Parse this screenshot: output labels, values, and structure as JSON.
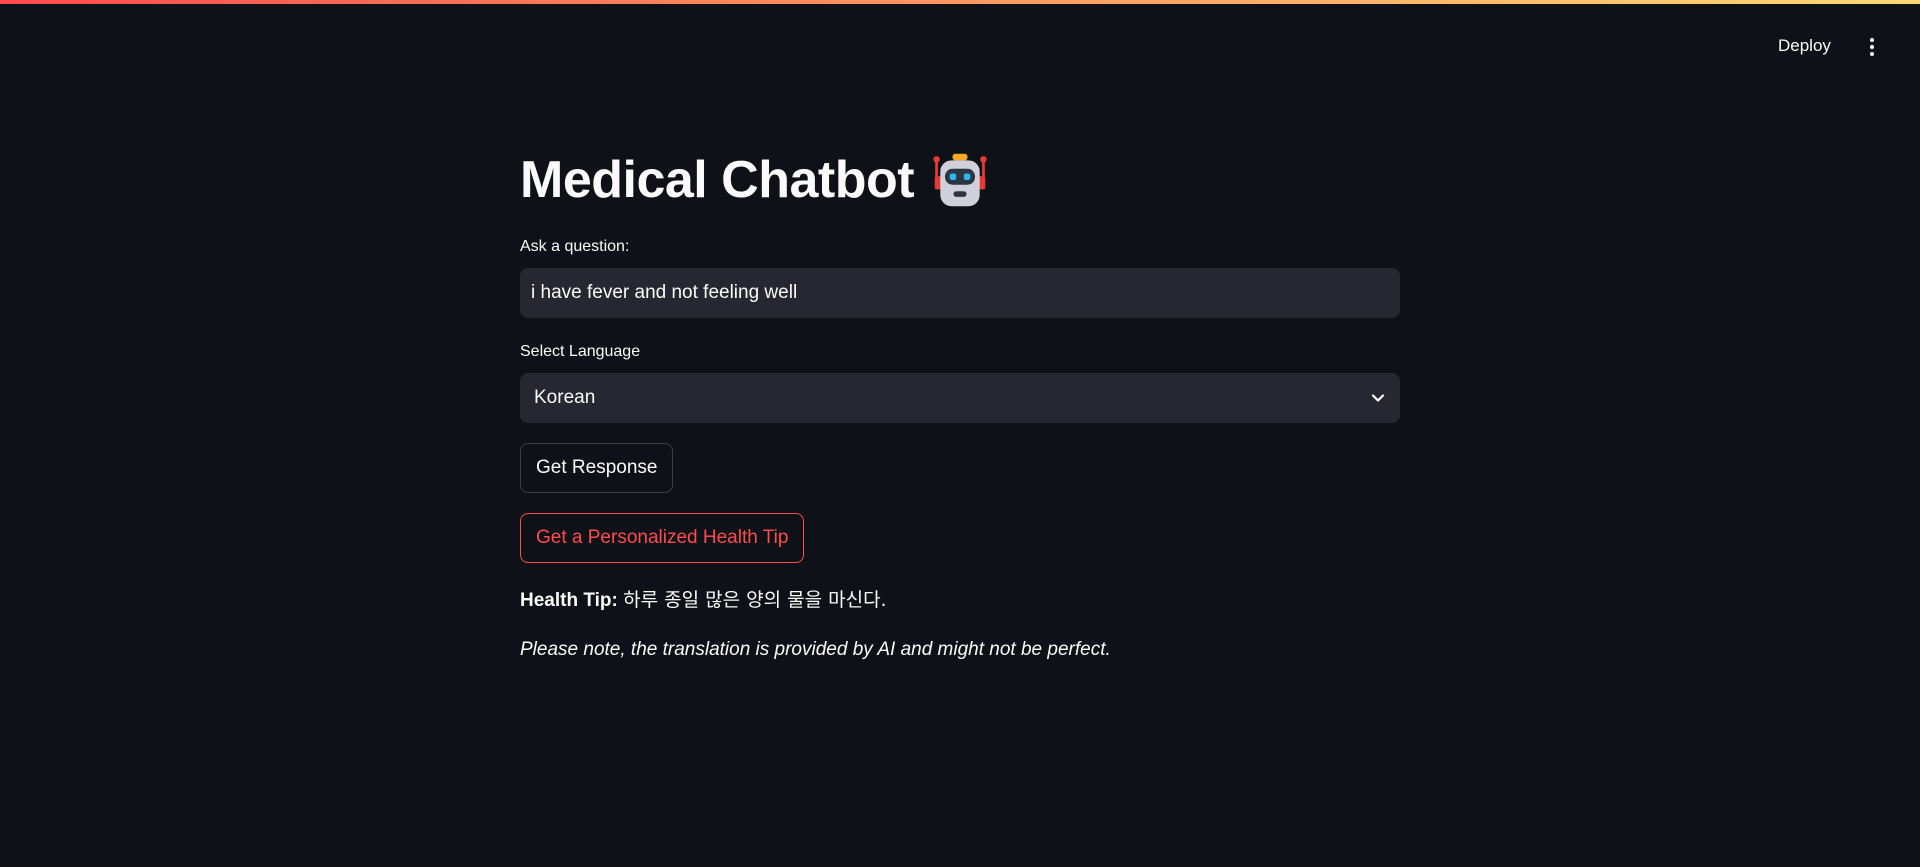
{
  "header": {
    "deploy_label": "Deploy",
    "menu_icon": "kebab-menu-icon"
  },
  "main": {
    "title": "Medical Chatbot",
    "title_icon": "robot-icon",
    "question": {
      "label": "Ask a question:",
      "value": "i have fever and not feeling well"
    },
    "language": {
      "label": "Select Language",
      "selected": "Korean",
      "icon": "chevron-down-icon"
    },
    "get_response_label": "Get Response",
    "health_tip_button_label": "Get a Personalized Health Tip",
    "health_tip": {
      "prefix": "Health Tip:",
      "text": "하루 종일 많은 양의 물을 마신다."
    },
    "note": "Please note, the translation is provided by AI and might not be perfect."
  },
  "colors": {
    "background": "#0e1117",
    "input_background": "#262730",
    "accent": "#ff4b4b",
    "text": "#fafafa"
  }
}
